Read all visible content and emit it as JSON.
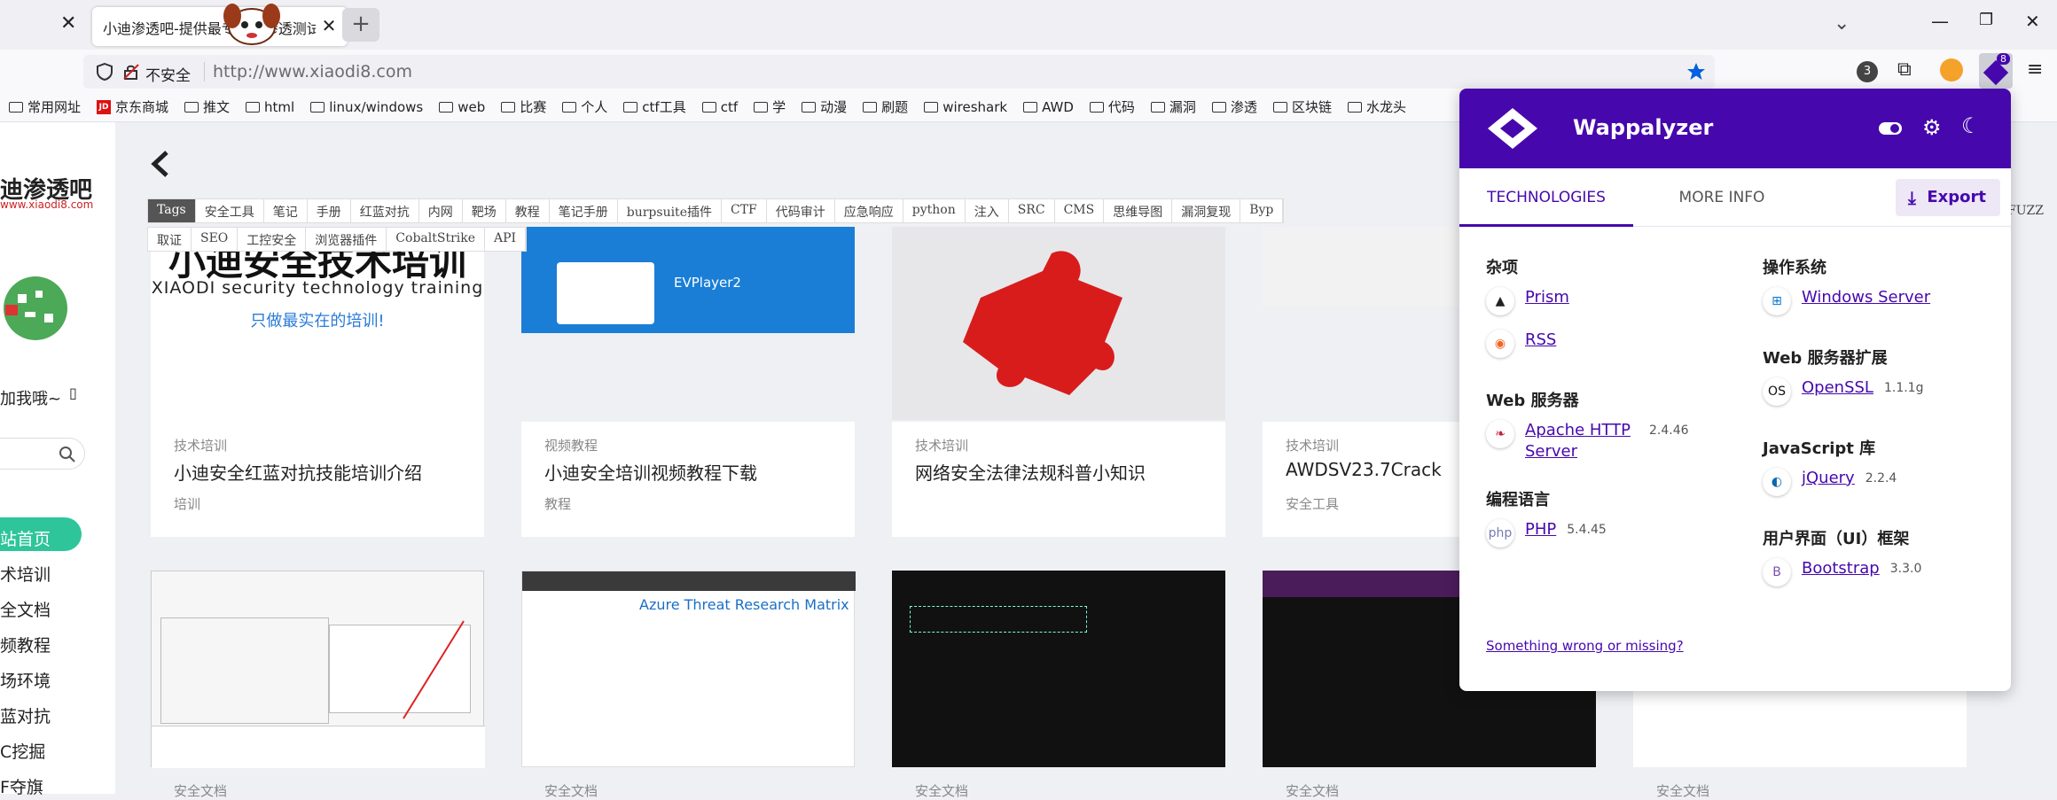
{
  "tab": {
    "title": "小迪渗透吧-提供最专业的渗透测试",
    "close": "✕",
    "new_tab": "+"
  },
  "toolbar": {
    "insecure_label": "不安全",
    "url": "http://www.xiaodi8.com",
    "badge_count": "3",
    "ext_count": "8"
  },
  "bookmarks": [
    "常用网址",
    "京东商城",
    "推文",
    "html",
    "linux/windows",
    "web",
    "比赛",
    "个人",
    "ctf工具",
    "ctf",
    "学",
    "动漫",
    "刷题",
    "wireshark",
    "AWD",
    "代码",
    "漏洞",
    "渗透",
    "区块链",
    "水龙头"
  ],
  "site": {
    "logo_title": "迪渗透吧",
    "logo_sub": "www.xiaodi8.com",
    "follow": "加我哦~",
    "nav": [
      "站首页",
      "术培训",
      "全文档",
      "频教程",
      "场环境",
      "蓝对抗",
      "C挖掘",
      "F夺旗"
    ],
    "filter_row1": [
      "Tags",
      "安全工具",
      "笔记",
      "手册",
      "红蓝对抗",
      "内网",
      "靶场",
      "教程",
      "笔记手册",
      "burpsuite插件",
      "CTF",
      "代码审计",
      "应急响应",
      "python",
      "注入",
      "SRC",
      "CMS",
      "思维导图",
      "漏洞复现",
      "Byp"
    ],
    "filter_row2": [
      "取证",
      "SEO",
      "工控安全",
      "浏览器插件",
      "CobaltStrike",
      "API"
    ],
    "fuzz": "FUZZ",
    "banner_title": "小迪安全技术培训",
    "banner_en": "XIAODI security technology training",
    "banner_slogan": "只做最实在的培训!",
    "player_title": "EVPlayer2",
    "azure_title": "Azure Threat Research Matrix",
    "cards": [
      {
        "category": "技术培训",
        "title": "小迪安全红蓝对抗技能培训介绍",
        "tag": "培训"
      },
      {
        "category": "视频教程",
        "title": "小迪安全培训视频教程下载",
        "tag": "教程"
      },
      {
        "category": "技术培训",
        "title": "网络安全法律法规科普小知识",
        "tag": ""
      },
      {
        "category": "技术培训",
        "title": "AWDSV23.7Crack",
        "tag": "安全工具"
      }
    ],
    "bottom_labels": [
      "安全文档",
      "安全文档",
      "安全文档",
      "安全文档",
      "安全文档"
    ]
  },
  "wappalyzer": {
    "name": "Wappalyzer",
    "tab_technologies": "TECHNOLOGIES",
    "tab_more_info": "MORE INFO",
    "export_label": "Export",
    "left": [
      {
        "category": "杂项",
        "items": [
          {
            "name": "Prism",
            "version": ""
          },
          {
            "name": "RSS",
            "version": ""
          }
        ]
      },
      {
        "category": "Web 服务器",
        "items": [
          {
            "name": "Apache HTTP Server",
            "version": "2.4.46"
          }
        ]
      },
      {
        "category": "编程语言",
        "items": [
          {
            "name": "PHP",
            "version": "5.4.45"
          }
        ]
      }
    ],
    "right": [
      {
        "category": "操作系统",
        "items": [
          {
            "name": "Windows Server",
            "version": ""
          }
        ]
      },
      {
        "category": "Web 服务器扩展",
        "items": [
          {
            "name": "OpenSSL",
            "version": "1.1.1g"
          }
        ]
      },
      {
        "category": "JavaScript 库",
        "items": [
          {
            "name": "jQuery",
            "version": "2.2.4"
          }
        ]
      },
      {
        "category": "用户界面（UI）框架",
        "items": [
          {
            "name": "Bootstrap",
            "version": "3.3.0"
          }
        ]
      }
    ],
    "footer_link": "Something wrong or missing?"
  }
}
